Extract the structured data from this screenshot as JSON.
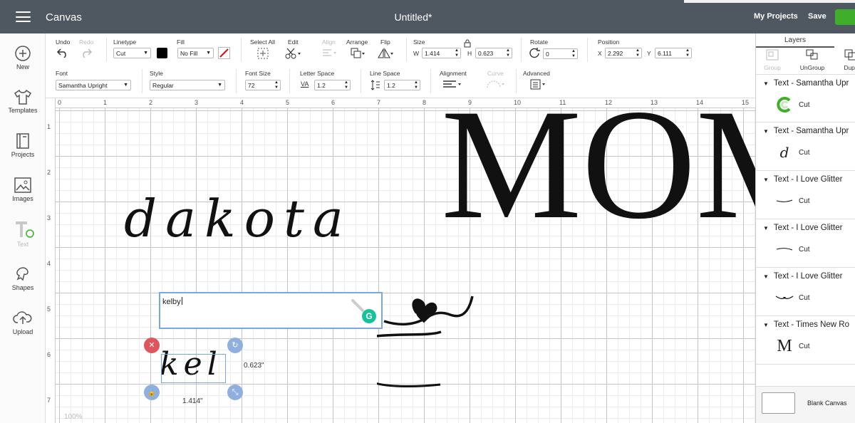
{
  "header": {
    "menu_icon": "hamburger-icon",
    "app_title": "Canvas",
    "doc_title": "Untitled*",
    "my_projects": "My Projects",
    "save": "Save"
  },
  "sidebar": {
    "items": [
      {
        "label": "New",
        "icon": "plus-circle-icon"
      },
      {
        "label": "Templates",
        "icon": "shirt-icon"
      },
      {
        "label": "Projects",
        "icon": "book-icon"
      },
      {
        "label": "Images",
        "icon": "image-icon"
      },
      {
        "label": "Text",
        "icon": "text-icon"
      },
      {
        "label": "Shapes",
        "icon": "shapes-icon"
      },
      {
        "label": "Upload",
        "icon": "upload-cloud-icon"
      }
    ]
  },
  "toolbar": {
    "undo": "Undo",
    "redo": "Redo",
    "linetype": "Linetype",
    "linetype_value": "Cut",
    "fill": "Fill",
    "fill_value": "No Fill",
    "select_all": "Select All",
    "edit": "Edit",
    "align": "Align",
    "arrange": "Arrange",
    "flip": "Flip",
    "size": "Size",
    "w_label": "W",
    "w_value": "1.414",
    "h_label": "H",
    "h_value": "0.623",
    "rotate": "Rotate",
    "rotate_value": "0",
    "position": "Position",
    "x_label": "X",
    "x_value": "2.292",
    "y_label": "Y",
    "y_value": "6.111",
    "font": "Font",
    "font_value": "Samantha Upright",
    "style": "Style",
    "style_value": "Regular",
    "font_size": "Font Size",
    "font_size_value": "72",
    "letter_space": "Letter Space",
    "letter_space_value": "1.2",
    "line_space": "Line Space",
    "line_space_value": "1.2",
    "alignment": "Alignment",
    "curve": "Curve",
    "advanced": "Advanced",
    "va_glyph": "VA"
  },
  "ruler": {
    "top": [
      "0",
      "1",
      "2",
      "3",
      "4",
      "5",
      "6",
      "7",
      "8",
      "9",
      "10",
      "11",
      "12",
      "13",
      "14",
      "15"
    ],
    "left": [
      "1",
      "2",
      "3",
      "4",
      "5",
      "6",
      "7"
    ]
  },
  "canvas": {
    "dakota_text": "dakota",
    "mom_text": "MOM",
    "edit_value": "kelby",
    "kel_text": "kel",
    "height_label": "0.623\"",
    "width_label": "1.414\"",
    "zoom": "100%",
    "grammarly_glyph": "G",
    "handles": {
      "delete": "✕",
      "rotate": "↻",
      "lock": "🔒",
      "scale": "⤡"
    }
  },
  "layers": {
    "title": "Layers",
    "group": "Group",
    "ungroup": "UnGroup",
    "duplicate": "Dupli",
    "items": [
      {
        "name": "Text - Samantha Upr",
        "op": "Cut",
        "thumb": "c"
      },
      {
        "name": "Text - Samantha Upr",
        "op": "Cut",
        "thumb": "d"
      },
      {
        "name": "Text - I Love Glitter",
        "op": "Cut",
        "thumb": "~"
      },
      {
        "name": "Text - I Love Glitter",
        "op": "Cut",
        "thumb": "~"
      },
      {
        "name": "Text - I Love Glitter",
        "op": "Cut",
        "thumb": "~"
      },
      {
        "name": "Text - Times New Ro",
        "op": "Cut",
        "thumb": "M"
      }
    ],
    "blank_canvas": "Blank Canvas"
  },
  "colors": {
    "topbar": "#4f5761",
    "accent": "#3fae2a",
    "selection": "#79a8e0",
    "delete": "#e0545b",
    "handle": "#8fb0de"
  }
}
